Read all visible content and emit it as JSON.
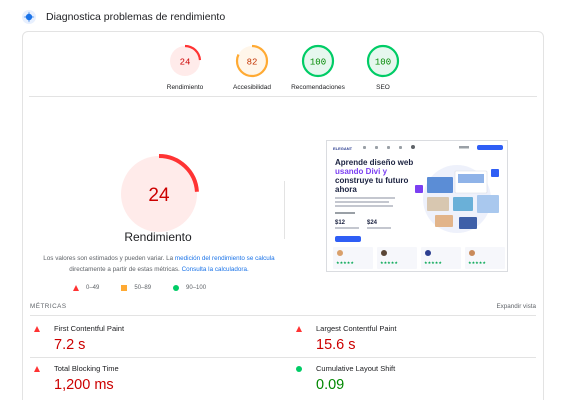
{
  "header": {
    "title": "Diagnostica problemas de rendimiento",
    "icon": "lighthouse-icon"
  },
  "scores": [
    {
      "label": "Rendimiento",
      "value": "24",
      "status": "fail",
      "color": "#ff3333",
      "text_color": "#cc0000",
      "bg": "#ffebea",
      "fraction": 0.24
    },
    {
      "label": "Accesibilidad",
      "value": "82",
      "status": "average",
      "color": "#ffaa33",
      "text_color": "#c33300",
      "bg": "#fff6ea",
      "fraction": 0.82
    },
    {
      "label": "Recomendaciones",
      "value": "100",
      "status": "pass",
      "color": "#00cc66",
      "text_color": "#008800",
      "bg": "#e6f7ee",
      "fraction": 1.0
    },
    {
      "label": "SEO",
      "value": "100",
      "status": "pass",
      "color": "#00cc66",
      "text_color": "#008800",
      "bg": "#e6f7ee",
      "fraction": 1.0
    }
  ],
  "performance": {
    "score": "24",
    "fraction": 0.24,
    "title": "Rendimiento",
    "note_part1": "Los valores son estimados y pueden variar. La ",
    "note_link1": "medición del rendimiento se calcula",
    "note_part2": " directamente a partir de estas métricas. ",
    "note_link2": "Consulta la calculadora."
  },
  "legend": [
    {
      "symbol": "triangle",
      "range": "0–49"
    },
    {
      "symbol": "square",
      "range": "50–89"
    },
    {
      "symbol": "circle",
      "range": "90–100"
    }
  ],
  "screenshot": {
    "logo": "ELEGANT",
    "headline_1": "Aprende diseño web",
    "headline_2": "usando Divi y",
    "headline_3": "construye tu futuro",
    "headline_4": "ahora",
    "price_1": "$12",
    "price_2": "$24",
    "stars": "★★★★★"
  },
  "metrics_header": {
    "title": "MÉTRICAS",
    "expand": "Expandir vista"
  },
  "metrics": [
    {
      "name": "First Contentful Paint",
      "value": "7.2 s",
      "status": "fail"
    },
    {
      "name": "Largest Contentful Paint",
      "value": "15.6 s",
      "status": "fail"
    },
    {
      "name": "Total Blocking Time",
      "value": "1,200 ms",
      "status": "fail"
    },
    {
      "name": "Cumulative Layout Shift",
      "value": "0.09",
      "status": "pass"
    }
  ]
}
